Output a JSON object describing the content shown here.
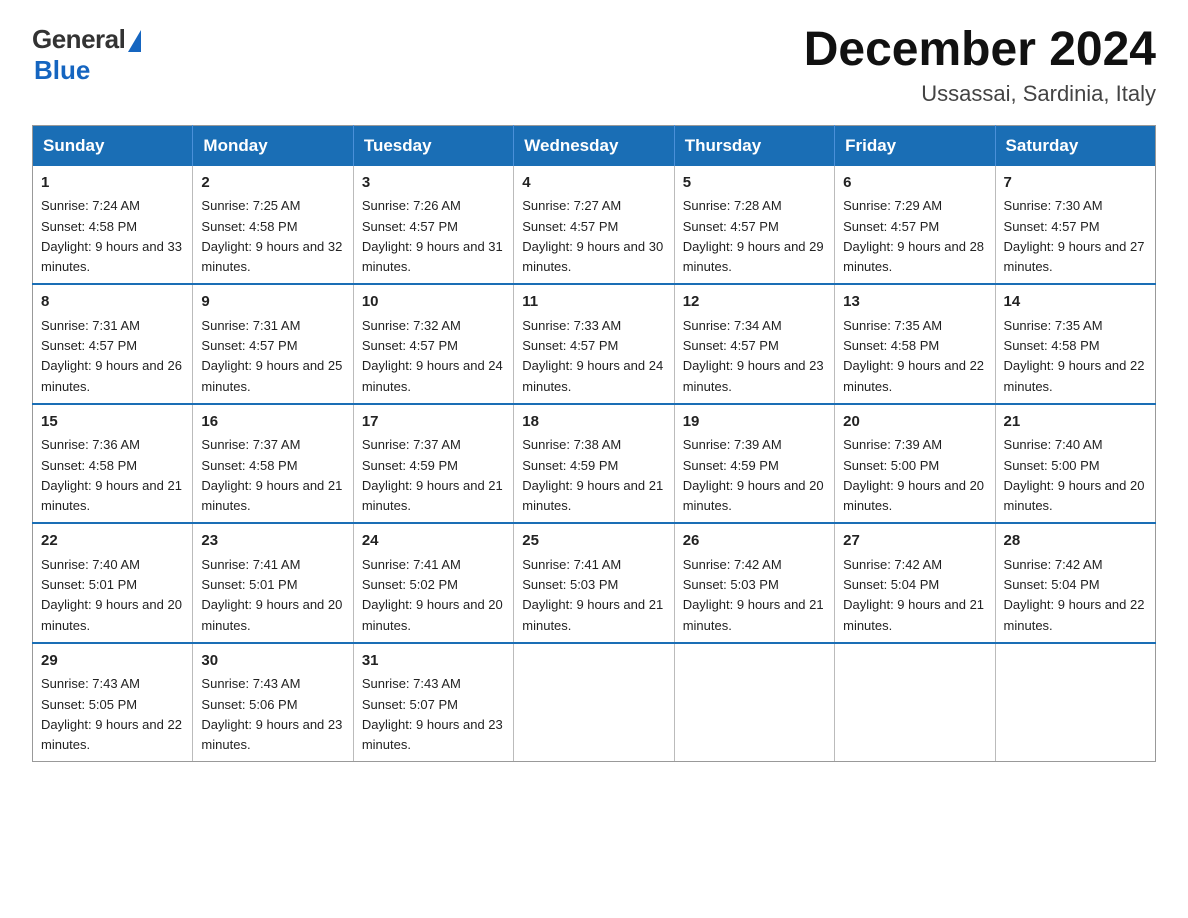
{
  "logo": {
    "general": "General",
    "blue": "Blue"
  },
  "title": "December 2024",
  "location": "Ussassai, Sardinia, Italy",
  "days_of_week": [
    "Sunday",
    "Monday",
    "Tuesday",
    "Wednesday",
    "Thursday",
    "Friday",
    "Saturday"
  ],
  "weeks": [
    [
      {
        "day": "1",
        "sunrise": "7:24 AM",
        "sunset": "4:58 PM",
        "daylight": "9 hours and 33 minutes."
      },
      {
        "day": "2",
        "sunrise": "7:25 AM",
        "sunset": "4:58 PM",
        "daylight": "9 hours and 32 minutes."
      },
      {
        "day": "3",
        "sunrise": "7:26 AM",
        "sunset": "4:57 PM",
        "daylight": "9 hours and 31 minutes."
      },
      {
        "day": "4",
        "sunrise": "7:27 AM",
        "sunset": "4:57 PM",
        "daylight": "9 hours and 30 minutes."
      },
      {
        "day": "5",
        "sunrise": "7:28 AM",
        "sunset": "4:57 PM",
        "daylight": "9 hours and 29 minutes."
      },
      {
        "day": "6",
        "sunrise": "7:29 AM",
        "sunset": "4:57 PM",
        "daylight": "9 hours and 28 minutes."
      },
      {
        "day": "7",
        "sunrise": "7:30 AM",
        "sunset": "4:57 PM",
        "daylight": "9 hours and 27 minutes."
      }
    ],
    [
      {
        "day": "8",
        "sunrise": "7:31 AM",
        "sunset": "4:57 PM",
        "daylight": "9 hours and 26 minutes."
      },
      {
        "day": "9",
        "sunrise": "7:31 AM",
        "sunset": "4:57 PM",
        "daylight": "9 hours and 25 minutes."
      },
      {
        "day": "10",
        "sunrise": "7:32 AM",
        "sunset": "4:57 PM",
        "daylight": "9 hours and 24 minutes."
      },
      {
        "day": "11",
        "sunrise": "7:33 AM",
        "sunset": "4:57 PM",
        "daylight": "9 hours and 24 minutes."
      },
      {
        "day": "12",
        "sunrise": "7:34 AM",
        "sunset": "4:57 PM",
        "daylight": "9 hours and 23 minutes."
      },
      {
        "day": "13",
        "sunrise": "7:35 AM",
        "sunset": "4:58 PM",
        "daylight": "9 hours and 22 minutes."
      },
      {
        "day": "14",
        "sunrise": "7:35 AM",
        "sunset": "4:58 PM",
        "daylight": "9 hours and 22 minutes."
      }
    ],
    [
      {
        "day": "15",
        "sunrise": "7:36 AM",
        "sunset": "4:58 PM",
        "daylight": "9 hours and 21 minutes."
      },
      {
        "day": "16",
        "sunrise": "7:37 AM",
        "sunset": "4:58 PM",
        "daylight": "9 hours and 21 minutes."
      },
      {
        "day": "17",
        "sunrise": "7:37 AM",
        "sunset": "4:59 PM",
        "daylight": "9 hours and 21 minutes."
      },
      {
        "day": "18",
        "sunrise": "7:38 AM",
        "sunset": "4:59 PM",
        "daylight": "9 hours and 21 minutes."
      },
      {
        "day": "19",
        "sunrise": "7:39 AM",
        "sunset": "4:59 PM",
        "daylight": "9 hours and 20 minutes."
      },
      {
        "day": "20",
        "sunrise": "7:39 AM",
        "sunset": "5:00 PM",
        "daylight": "9 hours and 20 minutes."
      },
      {
        "day": "21",
        "sunrise": "7:40 AM",
        "sunset": "5:00 PM",
        "daylight": "9 hours and 20 minutes."
      }
    ],
    [
      {
        "day": "22",
        "sunrise": "7:40 AM",
        "sunset": "5:01 PM",
        "daylight": "9 hours and 20 minutes."
      },
      {
        "day": "23",
        "sunrise": "7:41 AM",
        "sunset": "5:01 PM",
        "daylight": "9 hours and 20 minutes."
      },
      {
        "day": "24",
        "sunrise": "7:41 AM",
        "sunset": "5:02 PM",
        "daylight": "9 hours and 20 minutes."
      },
      {
        "day": "25",
        "sunrise": "7:41 AM",
        "sunset": "5:03 PM",
        "daylight": "9 hours and 21 minutes."
      },
      {
        "day": "26",
        "sunrise": "7:42 AM",
        "sunset": "5:03 PM",
        "daylight": "9 hours and 21 minutes."
      },
      {
        "day": "27",
        "sunrise": "7:42 AM",
        "sunset": "5:04 PM",
        "daylight": "9 hours and 21 minutes."
      },
      {
        "day": "28",
        "sunrise": "7:42 AM",
        "sunset": "5:04 PM",
        "daylight": "9 hours and 22 minutes."
      }
    ],
    [
      {
        "day": "29",
        "sunrise": "7:43 AM",
        "sunset": "5:05 PM",
        "daylight": "9 hours and 22 minutes."
      },
      {
        "day": "30",
        "sunrise": "7:43 AM",
        "sunset": "5:06 PM",
        "daylight": "9 hours and 23 minutes."
      },
      {
        "day": "31",
        "sunrise": "7:43 AM",
        "sunset": "5:07 PM",
        "daylight": "9 hours and 23 minutes."
      },
      null,
      null,
      null,
      null
    ]
  ]
}
